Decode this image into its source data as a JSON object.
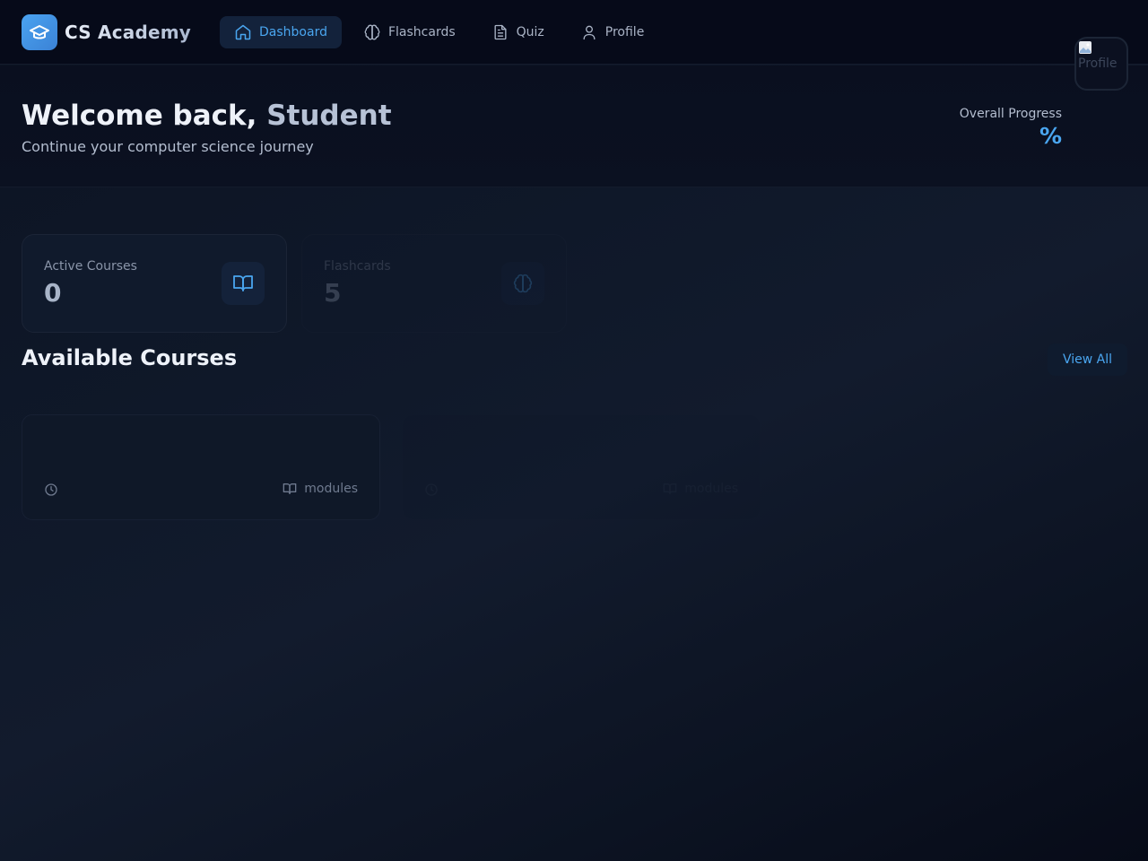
{
  "app": {
    "name": "CS Academy"
  },
  "nav": {
    "items": [
      {
        "label": "Dashboard",
        "icon": "home-icon",
        "active": true
      },
      {
        "label": "Flashcards",
        "icon": "brain-icon",
        "active": false
      },
      {
        "label": "Quiz",
        "icon": "document-icon",
        "active": false
      },
      {
        "label": "Profile",
        "icon": "user-icon",
        "active": false
      }
    ]
  },
  "hero": {
    "greeting": "Welcome back,",
    "name": "Student",
    "subtitle": "Continue your computer science journey",
    "progress_label": "Overall Progress",
    "progress_value": "%",
    "avatar_alt": "Profile"
  },
  "stats": [
    {
      "label": "Active Courses",
      "value": "0",
      "icon": "book-open-icon"
    },
    {
      "label": "Flashcards",
      "value": "5",
      "icon": "brain-icon"
    }
  ],
  "courses_section": {
    "title": "Available Courses",
    "view_all": "View All"
  },
  "courses": [
    {
      "title": "",
      "duration": "",
      "modules_label": "modules"
    },
    {
      "title": "",
      "duration": "",
      "modules_label": "modules"
    }
  ],
  "colors": {
    "accent": "#4aa6f0",
    "background": "#0c1322",
    "nav_background": "#060a19"
  }
}
